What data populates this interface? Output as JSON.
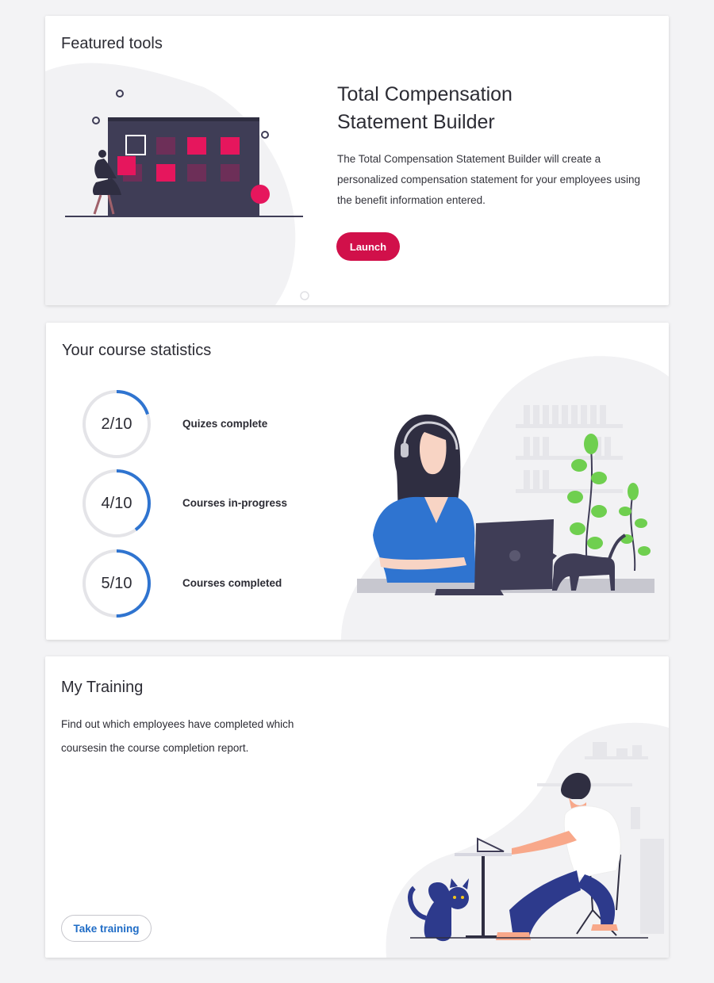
{
  "featured": {
    "title": "Featured tools",
    "tool_title_line1": "Total Compensation",
    "tool_title_line2": "Statement Builder",
    "description": "The Total Compensation Statement Builder will create a personalized compensation statement for your employees using the benefit information entered.",
    "launch_label": "Launch"
  },
  "stats": {
    "title": "Your course statistics",
    "items": [
      {
        "value": "2/10",
        "label": "Quizes complete",
        "fraction": 0.2
      },
      {
        "value": "4/10",
        "label": "Courses in-progress",
        "fraction": 0.4
      },
      {
        "value": "5/10",
        "label": "Courses completed",
        "fraction": 0.5
      }
    ]
  },
  "training": {
    "title": "My Training",
    "description": "Find out which employees have completed which coursesin the course completion report.",
    "button_label": "Take training"
  },
  "colors": {
    "accent": "#d1104a",
    "progress": "#2f74d0",
    "ring_track": "#e4e4e8",
    "link": "#1f6cc6"
  }
}
